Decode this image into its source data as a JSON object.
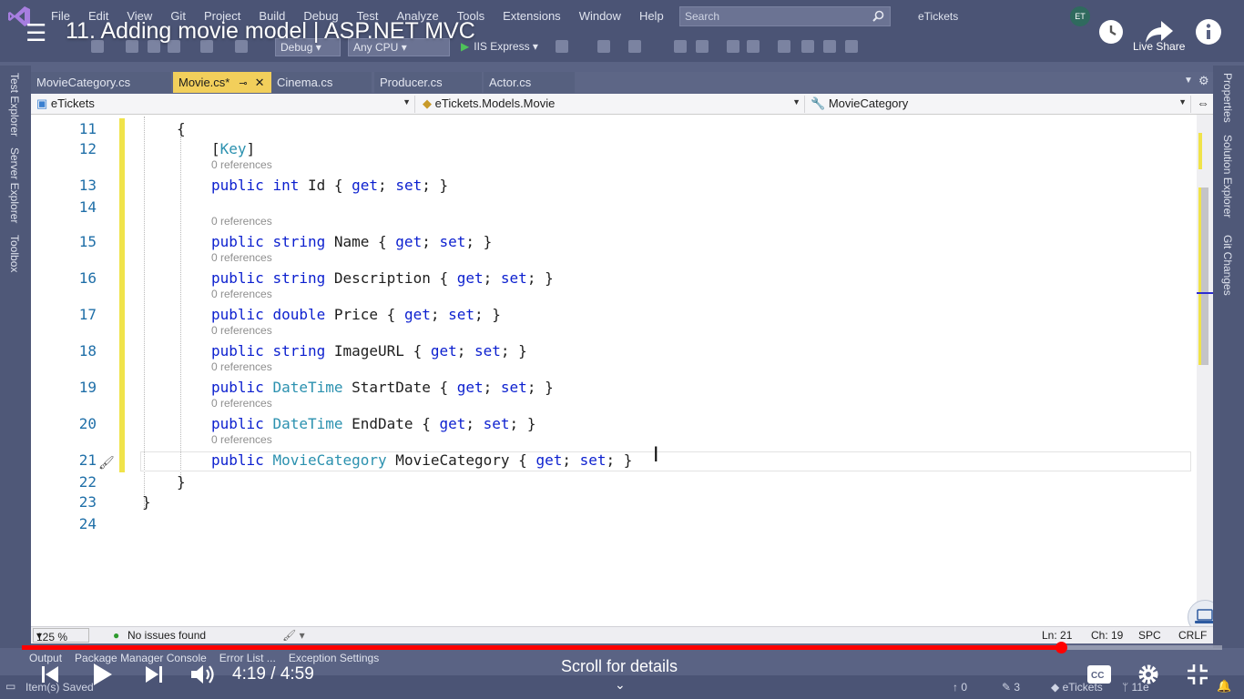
{
  "menubar": {
    "items": [
      "File",
      "Edit",
      "View",
      "Git",
      "Project",
      "Build",
      "Debug",
      "Test",
      "Analyze",
      "Tools",
      "Extensions",
      "Window",
      "Help"
    ],
    "search_placeholder": "Search",
    "solution_name": "eTickets",
    "avatar_initials": "ET"
  },
  "toolbar": {
    "config": "Debug",
    "platform": "Any CPU",
    "run_target": "IIS Express",
    "live_share": "Live Share"
  },
  "youtube": {
    "title": "11. Adding movie model | ASP.NET MVC",
    "current_time": "4:19",
    "separator": "/",
    "duration": "4:59",
    "progress": 0.866,
    "scroll_hint": "Scroll for details"
  },
  "side_left": [
    "Test Explorer",
    "Server Explorer",
    "Toolbox"
  ],
  "side_right": [
    "Properties",
    "Solution Explorer",
    "Git Changes"
  ],
  "tabs": [
    {
      "label": "MovieCategory.cs",
      "active": false
    },
    {
      "label": "Movie.cs*",
      "active": true
    },
    {
      "label": "Cinema.cs",
      "active": false
    },
    {
      "label": "Producer.cs",
      "active": false
    },
    {
      "label": "Actor.cs",
      "active": false
    }
  ],
  "navbar": {
    "project": "eTickets",
    "type": "eTickets.Models.Movie",
    "member": "MovieCategory"
  },
  "editor": {
    "lines": [
      {
        "n": "11",
        "tokens": [
          [
            "p",
            "{"
          ]
        ]
      },
      {
        "n": "12",
        "tokens": [
          [
            "p",
            "["
          ],
          [
            "t",
            "Key"
          ],
          [
            "p",
            "]"
          ]
        ]
      },
      {
        "n": "13",
        "refs": "0 references",
        "tokens": [
          [
            "k",
            "public"
          ],
          [
            "p",
            " "
          ],
          [
            "k",
            "int"
          ],
          [
            "p",
            " Id { "
          ],
          [
            "k",
            "get"
          ],
          [
            "p",
            "; "
          ],
          [
            "k",
            "set"
          ],
          [
            "p",
            "; }"
          ]
        ]
      },
      {
        "n": "14",
        "tokens": []
      },
      {
        "n": "15",
        "refs": "0 references",
        "tokens": [
          [
            "k",
            "public"
          ],
          [
            "p",
            " "
          ],
          [
            "k",
            "string"
          ],
          [
            "p",
            " Name { "
          ],
          [
            "k",
            "get"
          ],
          [
            "p",
            "; "
          ],
          [
            "k",
            "set"
          ],
          [
            "p",
            "; }"
          ]
        ]
      },
      {
        "n": "16",
        "refs": "0 references",
        "tokens": [
          [
            "k",
            "public"
          ],
          [
            "p",
            " "
          ],
          [
            "k",
            "string"
          ],
          [
            "p",
            " Description { "
          ],
          [
            "k",
            "get"
          ],
          [
            "p",
            "; "
          ],
          [
            "k",
            "set"
          ],
          [
            "p",
            "; }"
          ]
        ]
      },
      {
        "n": "17",
        "refs": "0 references",
        "tokens": [
          [
            "k",
            "public"
          ],
          [
            "p",
            " "
          ],
          [
            "k",
            "double"
          ],
          [
            "p",
            " Price { "
          ],
          [
            "k",
            "get"
          ],
          [
            "p",
            "; "
          ],
          [
            "k",
            "set"
          ],
          [
            "p",
            "; }"
          ]
        ]
      },
      {
        "n": "18",
        "refs": "0 references",
        "tokens": [
          [
            "k",
            "public"
          ],
          [
            "p",
            " "
          ],
          [
            "k",
            "string"
          ],
          [
            "p",
            " ImageURL { "
          ],
          [
            "k",
            "get"
          ],
          [
            "p",
            "; "
          ],
          [
            "k",
            "set"
          ],
          [
            "p",
            "; }"
          ]
        ]
      },
      {
        "n": "19",
        "refs": "0 references",
        "tokens": [
          [
            "k",
            "public"
          ],
          [
            "p",
            " "
          ],
          [
            "t",
            "DateTime"
          ],
          [
            "p",
            " StartDate { "
          ],
          [
            "k",
            "get"
          ],
          [
            "p",
            "; "
          ],
          [
            "k",
            "set"
          ],
          [
            "p",
            "; }"
          ]
        ]
      },
      {
        "n": "20",
        "refs": "0 references",
        "tokens": [
          [
            "k",
            "public"
          ],
          [
            "p",
            " "
          ],
          [
            "t",
            "DateTime"
          ],
          [
            "p",
            " EndDate { "
          ],
          [
            "k",
            "get"
          ],
          [
            "p",
            "; "
          ],
          [
            "k",
            "set"
          ],
          [
            "p",
            "; }"
          ]
        ]
      },
      {
        "n": "21",
        "refs": "0 references",
        "tokens": [
          [
            "k",
            "public"
          ],
          [
            "p",
            " "
          ],
          [
            "t",
            "MovieCategory"
          ],
          [
            "p",
            " MovieCategory { "
          ],
          [
            "k",
            "get"
          ],
          [
            "p",
            "; "
          ],
          [
            "k",
            "set"
          ],
          [
            "p",
            "; }"
          ]
        ]
      },
      {
        "n": "22",
        "tokens": [
          [
            "p",
            "}"
          ]
        ]
      },
      {
        "n": "23",
        "tokens": [
          [
            "p",
            "}"
          ]
        ]
      },
      {
        "n": "24",
        "tokens": []
      }
    ]
  },
  "status": {
    "zoom": "125 %",
    "issues": "No issues found",
    "line": "Ln: 21",
    "col": "Ch: 19",
    "whitespace": "SPC",
    "eol": "CRLF"
  },
  "bottom_tabs": [
    "Output",
    "Package Manager Console",
    "Error List ...",
    "Exception Settings"
  ],
  "vs_status": {
    "saved": "Item(s) Saved",
    "up": "0",
    "edits": "3",
    "repo": "eTickets",
    "branch": "11e"
  },
  "colors": {
    "keyword": "#0b1fcf",
    "type": "#2b91af",
    "line_number": "#1f6fa8",
    "active_tab": "#f2cf5b",
    "progress": "#ff0000"
  }
}
